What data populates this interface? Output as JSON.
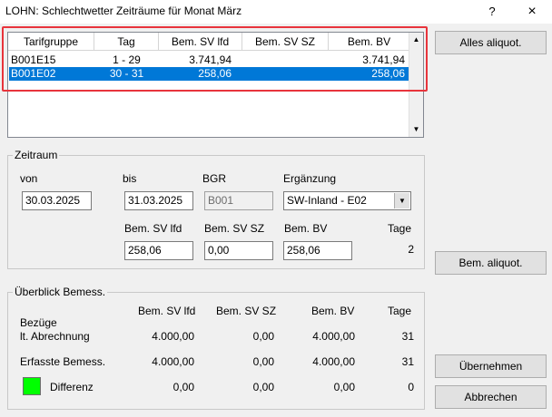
{
  "window": {
    "title": "LOHN: Schlechtwetter Zeiträume für Monat März",
    "help_glyph": "?",
    "close_glyph": "×"
  },
  "list": {
    "columns": [
      "Tarifgruppe",
      "Tag",
      "Bem. SV lfd",
      "Bem. SV SZ",
      "Bem. BV"
    ],
    "rows": [
      {
        "tarifgruppe": "B001E15",
        "tag": "1 - 29",
        "sv_lfd": "3.741,94",
        "sv_sz": "",
        "bv": "3.741,94",
        "selected": false
      },
      {
        "tarifgruppe": "B001E02",
        "tag": "30 - 31",
        "sv_lfd": "258,06",
        "sv_sz": "",
        "bv": "258,06",
        "selected": true
      }
    ]
  },
  "buttons": {
    "alles_aliquot": "Alles aliquot.",
    "bem_aliquot": "Bem. aliquot.",
    "uebernehmen": "Übernehmen",
    "abbrechen": "Abbrechen"
  },
  "zeitraum": {
    "legend": "Zeitraum",
    "von_label": "von",
    "von_value": "30.03.2025",
    "bis_label": "bis",
    "bis_value": "31.03.2025",
    "bgr_label": "BGR",
    "bgr_value": "B001",
    "ergaenzung_label": "Ergänzung",
    "ergaenzung_value": "SW-Inland - E02",
    "sv_lfd_label": "Bem. SV lfd",
    "sv_lfd_value": "258,06",
    "sv_sz_label": "Bem. SV SZ",
    "sv_sz_value": "0,00",
    "bv_label": "Bem. BV",
    "bv_value": "258,06",
    "tage_label": "Tage",
    "tage_value": "2"
  },
  "ueberblick": {
    "legend": "Überblick Bemess.",
    "headers": {
      "sv_lfd": "Bem. SV lfd",
      "sv_sz": "Bem. SV SZ",
      "bv": "Bem. BV",
      "tage": "Tage"
    },
    "bezuege_label1": "Bezüge",
    "bezuege_label2": "lt. Abrechnung",
    "bezuege": {
      "sv_lfd": "4.000,00",
      "sv_sz": "0,00",
      "bv": "4.000,00",
      "tage": "31"
    },
    "erfasste_label": "Erfasste Bemess.",
    "erfasste": {
      "sv_lfd": "4.000,00",
      "sv_sz": "0,00",
      "bv": "4.000,00",
      "tage": "31"
    },
    "differenz_label": "Differenz",
    "differenz": {
      "sv_lfd": "0,00",
      "sv_sz": "0,00",
      "bv": "0,00",
      "tage": "0"
    },
    "differenz_color": "#00ff00"
  },
  "highlight_color": "#e8343c",
  "selection_color": "#0078d7"
}
